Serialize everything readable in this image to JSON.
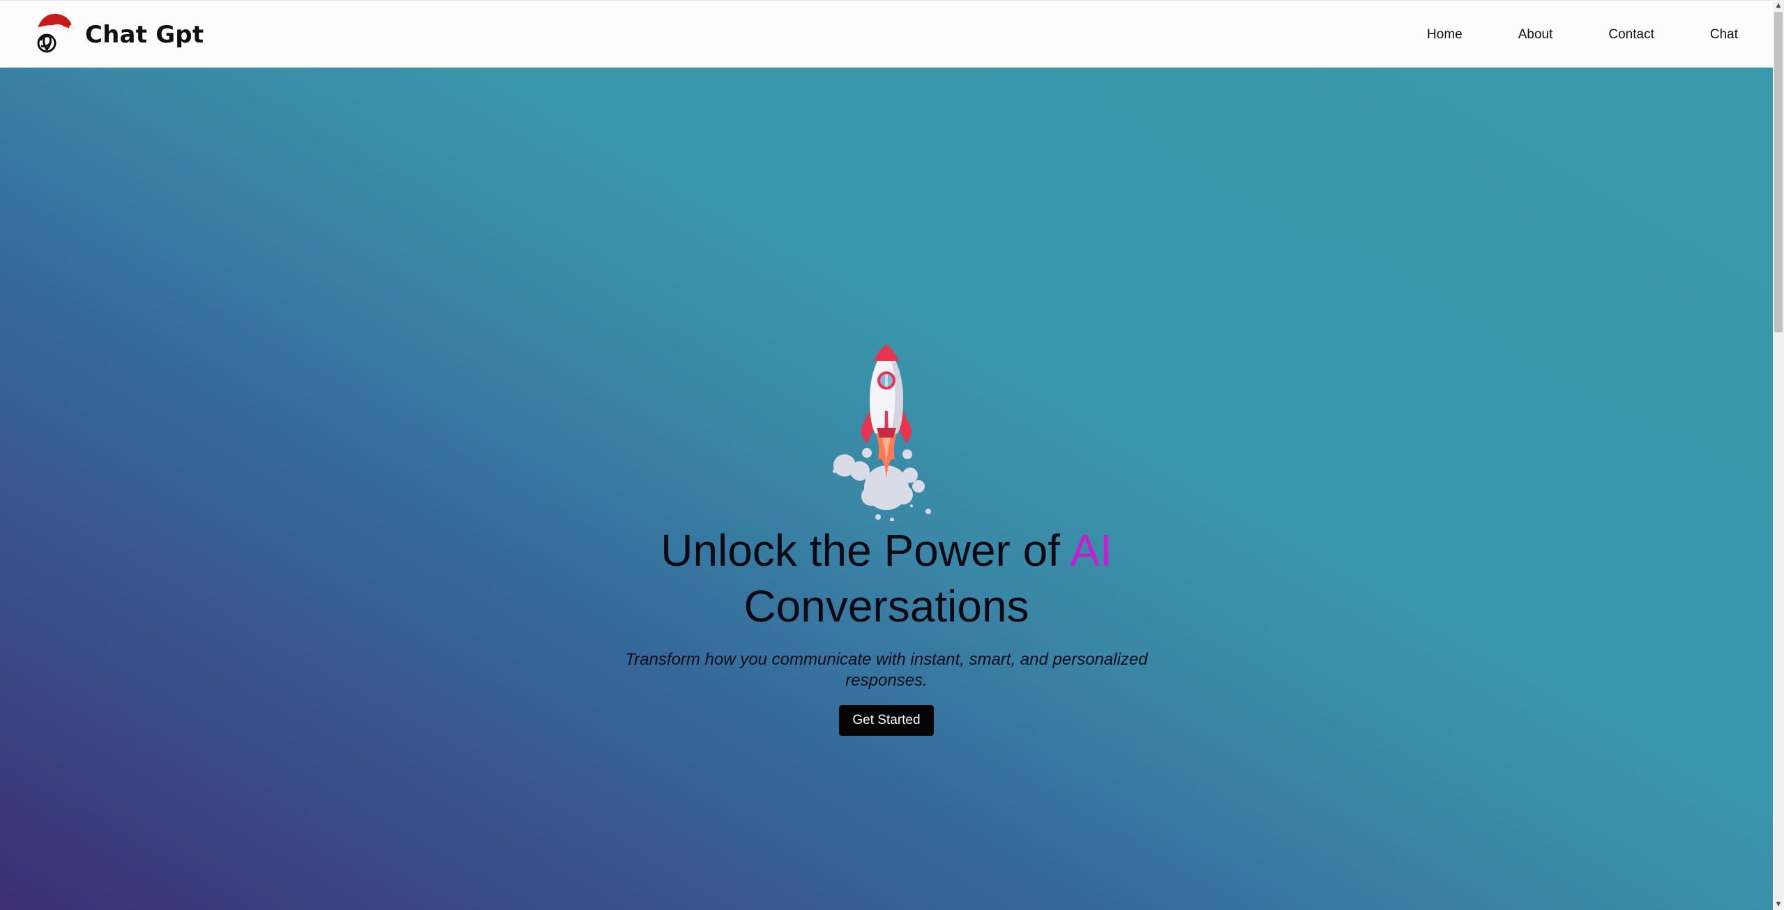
{
  "brand": {
    "name": "Chat Gpt",
    "logo_icon": "openai-logo-with-santa-hat-icon"
  },
  "nav": {
    "items": [
      {
        "label": "Home"
      },
      {
        "label": "About"
      },
      {
        "label": "Contact"
      },
      {
        "label": "Chat"
      }
    ]
  },
  "hero": {
    "illustration": "rocket-icon",
    "title_part1": "Unlock the Power of ",
    "title_accent": "AI",
    "title_part2": "Conversations",
    "subtitle": "Transform how you communicate with instant, smart, and personalized responses.",
    "cta_label": "Get Started"
  },
  "colors": {
    "accent": "#c020d0",
    "navbar_bg": "#fcfcfd",
    "hero_gradient_start": "#3c2f72",
    "hero_gradient_end": "#3998aa",
    "button_bg": "#050505"
  }
}
